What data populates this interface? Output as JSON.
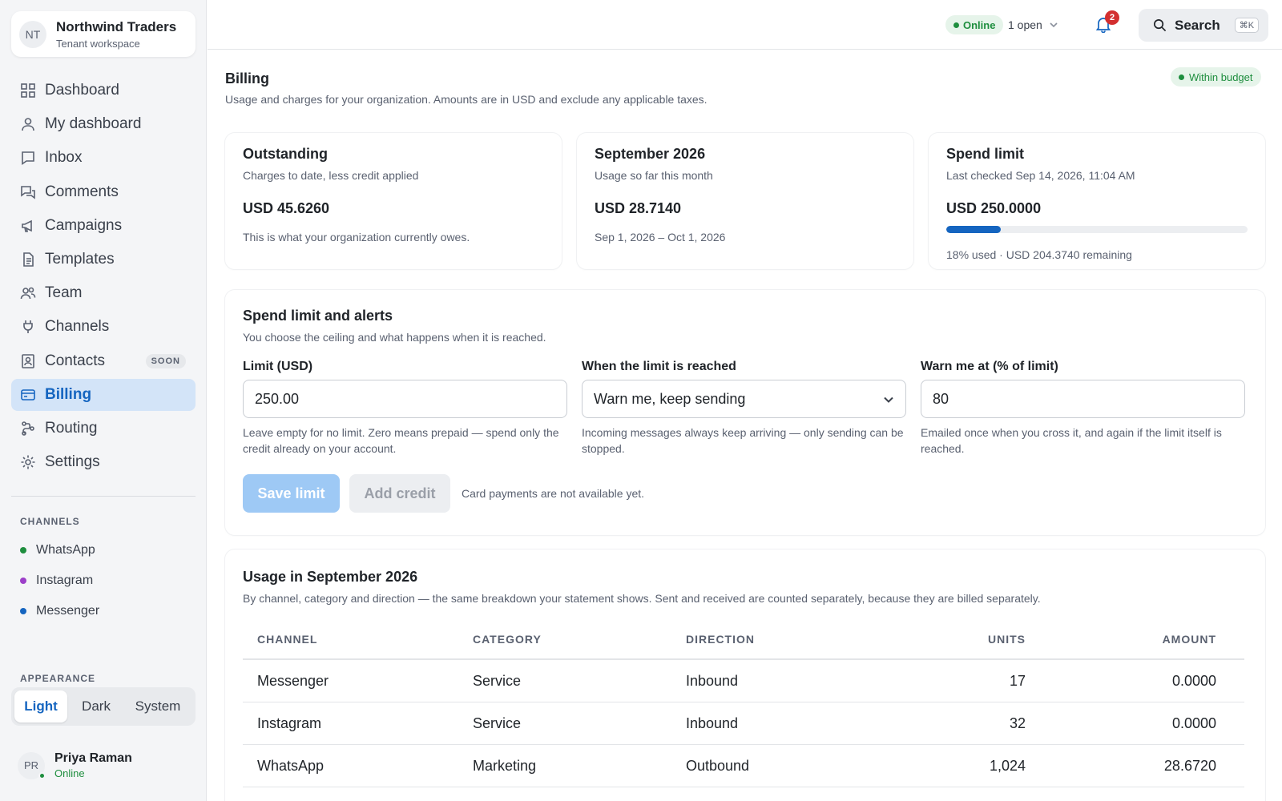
{
  "workspace": {
    "initials": "NT",
    "name": "Northwind Traders",
    "subtitle": "Tenant workspace"
  },
  "nav": {
    "items": [
      {
        "label": "Dashboard",
        "icon": "grid-icon"
      },
      {
        "label": "My dashboard",
        "icon": "user-icon"
      },
      {
        "label": "Inbox",
        "icon": "inbox-icon"
      },
      {
        "label": "Comments",
        "icon": "comments-icon"
      },
      {
        "label": "Campaigns",
        "icon": "megaphone-icon"
      },
      {
        "label": "Templates",
        "icon": "document-icon"
      },
      {
        "label": "Team",
        "icon": "team-icon"
      },
      {
        "label": "Channels",
        "icon": "plug-icon"
      },
      {
        "label": "Contacts",
        "icon": "contacts-icon",
        "badge": "SOON"
      },
      {
        "label": "Billing",
        "icon": "card-icon",
        "active": true
      },
      {
        "label": "Routing",
        "icon": "routing-icon"
      },
      {
        "label": "Settings",
        "icon": "gear-icon"
      }
    ]
  },
  "channels": {
    "heading": "CHANNELS",
    "items": [
      {
        "label": "WhatsApp",
        "color": "#1e8e3e"
      },
      {
        "label": "Instagram",
        "color": "#9c3fc9"
      },
      {
        "label": "Messenger",
        "color": "#1565c0"
      }
    ]
  },
  "appearance": {
    "heading": "APPEARANCE",
    "options": [
      "Light",
      "Dark",
      "System"
    ],
    "selected": "Light"
  },
  "user": {
    "initials": "PR",
    "name": "Priya Raman",
    "status": "Online"
  },
  "topbar": {
    "status": "Online",
    "open_count": "1 open",
    "notifications": "2",
    "search_label": "Search",
    "search_shortcut": "⌘K"
  },
  "page": {
    "title": "Billing",
    "subtitle": "Usage and charges for your organization. Amounts are in USD and exclude any applicable taxes.",
    "budget_status": "Within budget"
  },
  "stats": {
    "outstanding": {
      "title": "Outstanding",
      "subtitle": "Charges to date, less credit applied",
      "value": "USD 45.6260",
      "note": "This is what your organization currently owes."
    },
    "month": {
      "title": "September 2026",
      "subtitle": "Usage so far this month",
      "value": "USD 28.7140",
      "note": "Sep 1, 2026 – Oct 1, 2026"
    },
    "limit": {
      "title": "Spend limit",
      "subtitle": "Last checked Sep 14, 2026, 11:04 AM",
      "value": "USD 250.0000",
      "used_fraction": 0.18,
      "note": "18% used · USD 204.3740 remaining"
    }
  },
  "limit_form": {
    "title": "Spend limit and alerts",
    "subtitle": "You choose the ceiling and what happens when it is reached.",
    "limit_label": "Limit (USD)",
    "limit_value": "250.00",
    "limit_help": "Leave empty for no limit. Zero means prepaid — spend only the credit already on your account.",
    "action_label": "When the limit is reached",
    "action_value": "Warn me, keep sending",
    "action_help": "Incoming messages always keep arriving — only sending can be stopped.",
    "warn_label": "Warn me at (% of limit)",
    "warn_value": "80",
    "warn_help": "Emailed once when you cross it, and again if the limit itself is reached.",
    "save_label": "Save limit",
    "credit_label": "Add credit",
    "card_note": "Card payments are not available yet."
  },
  "usage": {
    "title": "Usage in September 2026",
    "subtitle": "By channel, category and direction — the same breakdown your statement shows. Sent and received are counted separately, because they are billed separately.",
    "columns": [
      "CHANNEL",
      "CATEGORY",
      "DIRECTION",
      "UNITS",
      "AMOUNT"
    ],
    "rows": [
      {
        "channel": "Messenger",
        "category": "Service",
        "direction": "Inbound",
        "units": "17",
        "amount": "0.0000"
      },
      {
        "channel": "Instagram",
        "category": "Service",
        "direction": "Inbound",
        "units": "32",
        "amount": "0.0000"
      },
      {
        "channel": "WhatsApp",
        "category": "Marketing",
        "direction": "Outbound",
        "units": "1,024",
        "amount": "28.6720"
      }
    ]
  }
}
